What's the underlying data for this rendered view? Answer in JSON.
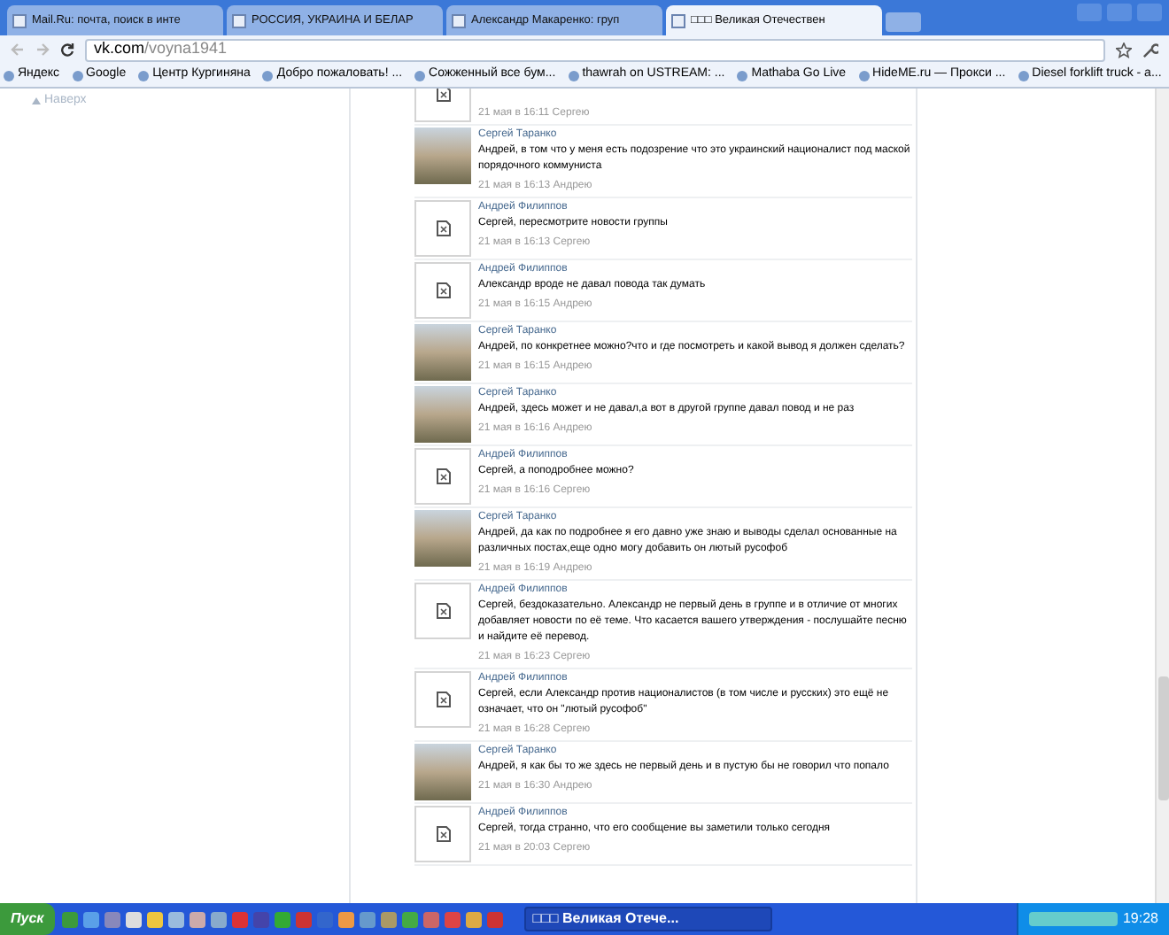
{
  "tabs": [
    {
      "title": "Mail.Ru: почта, поиск в инте",
      "selected": false
    },
    {
      "title": "РОССИЯ, УКРАИНА И БЕЛАР",
      "selected": false
    },
    {
      "title": "Александр Макаренко: груп",
      "selected": false
    },
    {
      "title": "□□□ Великая Отечествен",
      "selected": true
    }
  ],
  "address": {
    "host": "vk.com",
    "path": "/voyna1941"
  },
  "bookmarks": [
    "Яндекс",
    "Google",
    "Центр Кургиняна",
    "Добро пожаловать! ...",
    "Сожженный все бум...",
    "thawrah on USTREAM: ...",
    "Mathaba Go Live",
    "HideME.ru — Прокси ...",
    "Diesel forklift truck - a..."
  ],
  "sidebar": {
    "up_link": "Наверх"
  },
  "comments": [
    {
      "kind": "default",
      "meta": "21 мая в 16:11 Сергею"
    },
    {
      "kind": "photo",
      "author": "Сергей Таранко",
      "text": "Андрей, в том что у меня есть подозрение что это украинский националист под маской порядочного коммуниста",
      "meta": "21 мая в 16:13 Андрею"
    },
    {
      "kind": "default",
      "author": "Андрей Филиппов",
      "text": "Сергей, пересмотрите новости группы",
      "meta": "21 мая в 16:13 Сергею"
    },
    {
      "kind": "default",
      "author": "Андрей Филиппов",
      "text": "Александр вроде не давал повода так думать",
      "meta": "21 мая в 16:15 Андрею"
    },
    {
      "kind": "photo",
      "author": "Сергей Таранко",
      "text": "Андрей, по конкретнее можно?что и где посмотреть и какой вывод я должен сделать?",
      "meta": "21 мая в 16:15 Андрею"
    },
    {
      "kind": "photo",
      "author": "Сергей Таранко",
      "text": "Андрей, здесь может и не давал,а вот в другой группе давал повод и не раз",
      "meta": "21 мая в 16:16 Андрею"
    },
    {
      "kind": "default",
      "author": "Андрей Филиппов",
      "text": "Сергей, а поподробнее можно?",
      "meta": "21 мая в 16:16 Сергею"
    },
    {
      "kind": "photo",
      "author": "Сергей Таранко",
      "text": "Андрей, да как по подробнее я его давно уже знаю и выводы сделал основанные на различных постах,еще одно могу добавить он лютый русофоб",
      "meta": "21 мая в 16:19 Андрею"
    },
    {
      "kind": "default",
      "author": "Андрей Филиппов",
      "text": "Сергей, бездоказательно. Александр не первый день в группе и в отличие от многих добавляет новости по её теме. Что касается вашего утверждения - послушайте песню и найдите её перевод.",
      "meta": "21 мая в 16:23 Сергею"
    },
    {
      "kind": "default",
      "author": "Андрей Филиппов",
      "text": "Сергей, если Александр против националистов (в том числе и русских) это ещё не означает, что он \"лютый русофоб\"",
      "meta": "21 мая в 16:28 Сергею"
    },
    {
      "kind": "photo",
      "author": "Сергей Таранко",
      "text": "Андрей, я как бы то же здесь не первый день и в пустую бы не говорил что попало",
      "meta": "21 мая в 16:30 Андрею"
    },
    {
      "kind": "default",
      "author": "Андрей Филиппов",
      "text": "Сергей, тогда странно, что его сообщение вы заметили только сегодня",
      "meta": "21 мая в 20:03 Сергею"
    }
  ],
  "taskbar": {
    "start": "Пуск",
    "task": "□□□ Великая Отече...",
    "clock": "19:28"
  }
}
